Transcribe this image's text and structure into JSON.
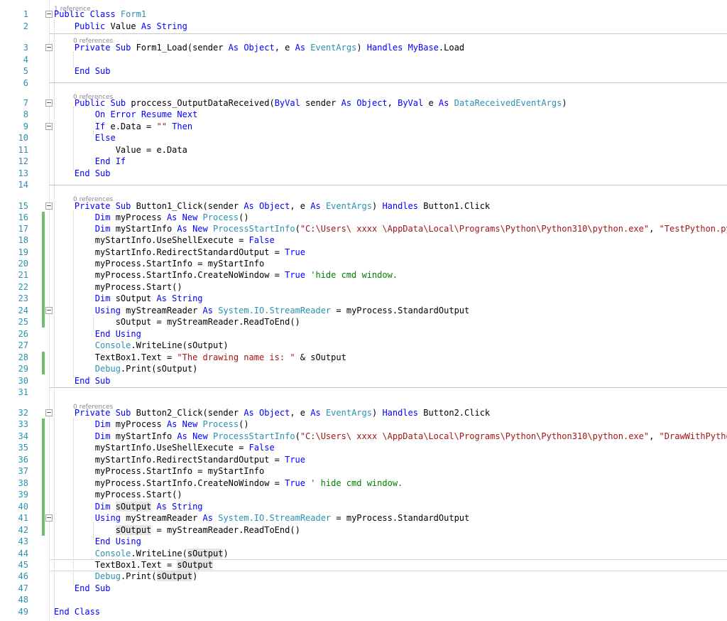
{
  "colors": {
    "keyword": "#0000ff",
    "type": "#2b91af",
    "string": "#a31515",
    "comment": "#008000",
    "plain": "#000000",
    "line_number": "#2b91af",
    "reference": "#8a8a8a",
    "highlight": "#e6e6e6"
  },
  "reference_hints": [
    {
      "text": "1 reference",
      "before_line": 1
    },
    {
      "text": "0 references",
      "before_line": 3
    },
    {
      "text": "0 references",
      "before_line": 7
    },
    {
      "text": "0 references",
      "before_line": 15
    },
    {
      "text": "0 references",
      "before_line": 32
    }
  ],
  "code_lines": [
    {
      "n": "1",
      "segs": [
        [
          "k",
          "Public Class "
        ],
        [
          "t",
          "Form1"
        ]
      ]
    },
    {
      "n": "2",
      "segs": [
        [
          "p",
          "    "
        ],
        [
          "k",
          "Public "
        ],
        [
          "p",
          "Value "
        ],
        [
          "k",
          "As String"
        ]
      ]
    },
    {
      "n": "3",
      "segs": [
        [
          "p",
          "    "
        ],
        [
          "k",
          "Private Sub "
        ],
        [
          "p",
          "Form1_Load(sender "
        ],
        [
          "k",
          "As Object"
        ],
        [
          "p",
          ", e "
        ],
        [
          "k",
          "As "
        ],
        [
          "t",
          "EventArgs"
        ],
        [
          "p",
          ") "
        ],
        [
          "k",
          "Handles MyBase"
        ],
        [
          "p",
          ".Load"
        ]
      ]
    },
    {
      "n": "4",
      "segs": []
    },
    {
      "n": "5",
      "segs": [
        [
          "p",
          "    "
        ],
        [
          "k",
          "End Sub"
        ]
      ]
    },
    {
      "n": "6",
      "segs": []
    },
    {
      "n": "7",
      "segs": [
        [
          "p",
          "    "
        ],
        [
          "k",
          "Public Sub "
        ],
        [
          "p",
          "proccess_OutputDataReceived("
        ],
        [
          "k",
          "ByVal "
        ],
        [
          "p",
          "sender "
        ],
        [
          "k",
          "As Object"
        ],
        [
          "p",
          ", "
        ],
        [
          "k",
          "ByVal "
        ],
        [
          "p",
          "e "
        ],
        [
          "k",
          "As "
        ],
        [
          "t",
          "DataReceivedEventArgs"
        ],
        [
          "p",
          ")"
        ]
      ]
    },
    {
      "n": "8",
      "segs": [
        [
          "p",
          "        "
        ],
        [
          "k",
          "On Error Resume Next"
        ]
      ]
    },
    {
      "n": "9",
      "segs": [
        [
          "p",
          "        "
        ],
        [
          "k",
          "If "
        ],
        [
          "p",
          "e.Data = "
        ],
        [
          "s",
          "\"\""
        ],
        [
          "k",
          " Then"
        ]
      ]
    },
    {
      "n": "10",
      "segs": [
        [
          "p",
          "        "
        ],
        [
          "k",
          "Else"
        ]
      ]
    },
    {
      "n": "11",
      "segs": [
        [
          "p",
          "            Value = e.Data"
        ]
      ]
    },
    {
      "n": "12",
      "segs": [
        [
          "p",
          "        "
        ],
        [
          "k",
          "End If"
        ]
      ]
    },
    {
      "n": "13",
      "segs": [
        [
          "p",
          "    "
        ],
        [
          "k",
          "End Sub"
        ]
      ]
    },
    {
      "n": "14",
      "segs": []
    },
    {
      "n": "15",
      "segs": [
        [
          "p",
          "    "
        ],
        [
          "k",
          "Private Sub "
        ],
        [
          "p",
          "Button1_Click(sender "
        ],
        [
          "k",
          "As Object"
        ],
        [
          "p",
          ", e "
        ],
        [
          "k",
          "As "
        ],
        [
          "t",
          "EventArgs"
        ],
        [
          "p",
          ") "
        ],
        [
          "k",
          "Handles "
        ],
        [
          "p",
          "Button1.Click"
        ]
      ]
    },
    {
      "n": "16",
      "segs": [
        [
          "p",
          "        "
        ],
        [
          "k",
          "Dim "
        ],
        [
          "p",
          "myProcess "
        ],
        [
          "k",
          "As New "
        ],
        [
          "t",
          "Process"
        ],
        [
          "p",
          "()"
        ]
      ]
    },
    {
      "n": "17",
      "segs": [
        [
          "p",
          "        "
        ],
        [
          "k",
          "Dim "
        ],
        [
          "p",
          "myStartInfo "
        ],
        [
          "k",
          "As New "
        ],
        [
          "t",
          "ProcessStartInfo"
        ],
        [
          "p",
          "("
        ],
        [
          "s",
          "\"C:\\Users\\ xxxx \\AppData\\Local\\Programs\\Python\\Python310\\python.exe\""
        ],
        [
          "p",
          ", "
        ],
        [
          "s",
          "\"TestPython.py\""
        ],
        [
          "p",
          ")"
        ]
      ]
    },
    {
      "n": "18",
      "segs": [
        [
          "p",
          "        myStartInfo.UseShellExecute = "
        ],
        [
          "k",
          "False"
        ]
      ]
    },
    {
      "n": "19",
      "segs": [
        [
          "p",
          "        myStartInfo.RedirectStandardOutput = "
        ],
        [
          "k",
          "True"
        ]
      ]
    },
    {
      "n": "20",
      "segs": [
        [
          "p",
          "        myProcess.StartInfo = myStartInfo"
        ]
      ]
    },
    {
      "n": "21",
      "segs": [
        [
          "p",
          "        myProcess.StartInfo.CreateNoWindow = "
        ],
        [
          "k",
          "True "
        ],
        [
          "c",
          "'hide cmd window."
        ]
      ]
    },
    {
      "n": "22",
      "segs": [
        [
          "p",
          "        myProcess.Start()"
        ]
      ]
    },
    {
      "n": "23",
      "segs": [
        [
          "p",
          "        "
        ],
        [
          "k",
          "Dim "
        ],
        [
          "p",
          "sOutput "
        ],
        [
          "k",
          "As String"
        ]
      ]
    },
    {
      "n": "24",
      "segs": [
        [
          "p",
          "        "
        ],
        [
          "k",
          "Using "
        ],
        [
          "p",
          "myStreamReader "
        ],
        [
          "k",
          "As "
        ],
        [
          "t",
          "System.IO.StreamReader"
        ],
        [
          "p",
          " = myProcess.StandardOutput"
        ]
      ]
    },
    {
      "n": "25",
      "segs": [
        [
          "p",
          "            sOutput = myStreamReader.ReadToEnd()"
        ]
      ]
    },
    {
      "n": "26",
      "segs": [
        [
          "p",
          "        "
        ],
        [
          "k",
          "End Using"
        ]
      ]
    },
    {
      "n": "27",
      "segs": [
        [
          "p",
          "        "
        ],
        [
          "t",
          "Console"
        ],
        [
          "p",
          ".WriteLine(sOutput)"
        ]
      ]
    },
    {
      "n": "28",
      "segs": [
        [
          "p",
          "        TextBox1.Text = "
        ],
        [
          "s",
          "\"The drawing name is: \""
        ],
        [
          "p",
          " & sOutput"
        ]
      ]
    },
    {
      "n": "29",
      "segs": [
        [
          "p",
          "        "
        ],
        [
          "t",
          "Debug"
        ],
        [
          "p",
          ".Print(sOutput)"
        ]
      ]
    },
    {
      "n": "30",
      "segs": [
        [
          "p",
          "    "
        ],
        [
          "k",
          "End Sub"
        ]
      ]
    },
    {
      "n": "31",
      "segs": []
    },
    {
      "n": "32",
      "segs": [
        [
          "p",
          "    "
        ],
        [
          "k",
          "Private Sub "
        ],
        [
          "p",
          "Button2_Click(sender "
        ],
        [
          "k",
          "As Object"
        ],
        [
          "p",
          ", e "
        ],
        [
          "k",
          "As "
        ],
        [
          "t",
          "EventArgs"
        ],
        [
          "p",
          ") "
        ],
        [
          "k",
          "Handles "
        ],
        [
          "p",
          "Button2.Click"
        ]
      ]
    },
    {
      "n": "33",
      "segs": [
        [
          "p",
          "        "
        ],
        [
          "k",
          "Dim "
        ],
        [
          "p",
          "myProcess "
        ],
        [
          "k",
          "As New "
        ],
        [
          "t",
          "Process"
        ],
        [
          "p",
          "()"
        ]
      ]
    },
    {
      "n": "34",
      "segs": [
        [
          "p",
          "        "
        ],
        [
          "k",
          "Dim "
        ],
        [
          "p",
          "myStartInfo "
        ],
        [
          "k",
          "As New "
        ],
        [
          "t",
          "ProcessStartInfo"
        ],
        [
          "p",
          "("
        ],
        [
          "s",
          "\"C:\\Users\\ xxxx \\AppData\\Local\\Programs\\Python\\Python310\\python.exe\""
        ],
        [
          "p",
          ", "
        ],
        [
          "s",
          "\"DrawWithPython.py\""
        ],
        [
          "p",
          ")"
        ]
      ]
    },
    {
      "n": "35",
      "segs": [
        [
          "p",
          "        myStartInfo.UseShellExecute = "
        ],
        [
          "k",
          "False"
        ]
      ]
    },
    {
      "n": "36",
      "segs": [
        [
          "p",
          "        myStartInfo.RedirectStandardOutput = "
        ],
        [
          "k",
          "True"
        ]
      ]
    },
    {
      "n": "37",
      "segs": [
        [
          "p",
          "        myProcess.StartInfo = myStartInfo"
        ]
      ]
    },
    {
      "n": "38",
      "segs": [
        [
          "p",
          "        myProcess.StartInfo.CreateNoWindow = "
        ],
        [
          "k",
          "True "
        ],
        [
          "c",
          "' hide cmd window."
        ]
      ]
    },
    {
      "n": "39",
      "segs": [
        [
          "p",
          "        myProcess.Start()"
        ]
      ]
    },
    {
      "n": "40",
      "segs": [
        [
          "p",
          "        "
        ],
        [
          "k",
          "Dim "
        ],
        [
          "h",
          "sOutput"
        ],
        [
          "k",
          " As String"
        ]
      ]
    },
    {
      "n": "41",
      "segs": [
        [
          "p",
          "        "
        ],
        [
          "k",
          "Using "
        ],
        [
          "p",
          "myStreamReader "
        ],
        [
          "k",
          "As "
        ],
        [
          "t",
          "System.IO.StreamReader"
        ],
        [
          "p",
          " = myProcess.StandardOutput"
        ]
      ]
    },
    {
      "n": "42",
      "segs": [
        [
          "p",
          "            "
        ],
        [
          "h",
          "sOutput"
        ],
        [
          "p",
          " = myStreamReader.ReadToEnd()"
        ]
      ]
    },
    {
      "n": "43",
      "segs": [
        [
          "p",
          "        "
        ],
        [
          "k",
          "End Using"
        ]
      ]
    },
    {
      "n": "44",
      "segs": [
        [
          "p",
          "        "
        ],
        [
          "t",
          "Console"
        ],
        [
          "p",
          ".WriteLine("
        ],
        [
          "h",
          "sOutput"
        ],
        [
          "p",
          ")"
        ]
      ]
    },
    {
      "n": "45",
      "segs": [
        [
          "p",
          "        TextBox1.Text = "
        ],
        [
          "h",
          "sOutput"
        ]
      ]
    },
    {
      "n": "46",
      "segs": [
        [
          "p",
          "        "
        ],
        [
          "t",
          "Debug"
        ],
        [
          "p",
          ".Print("
        ],
        [
          "h",
          "sOutput"
        ],
        [
          "p",
          ")"
        ]
      ]
    },
    {
      "n": "47",
      "segs": [
        [
          "p",
          "    "
        ],
        [
          "k",
          "End Sub"
        ]
      ]
    },
    {
      "n": "48",
      "segs": []
    },
    {
      "n": "49",
      "segs": [
        [
          "k",
          "End Class"
        ]
      ]
    }
  ]
}
